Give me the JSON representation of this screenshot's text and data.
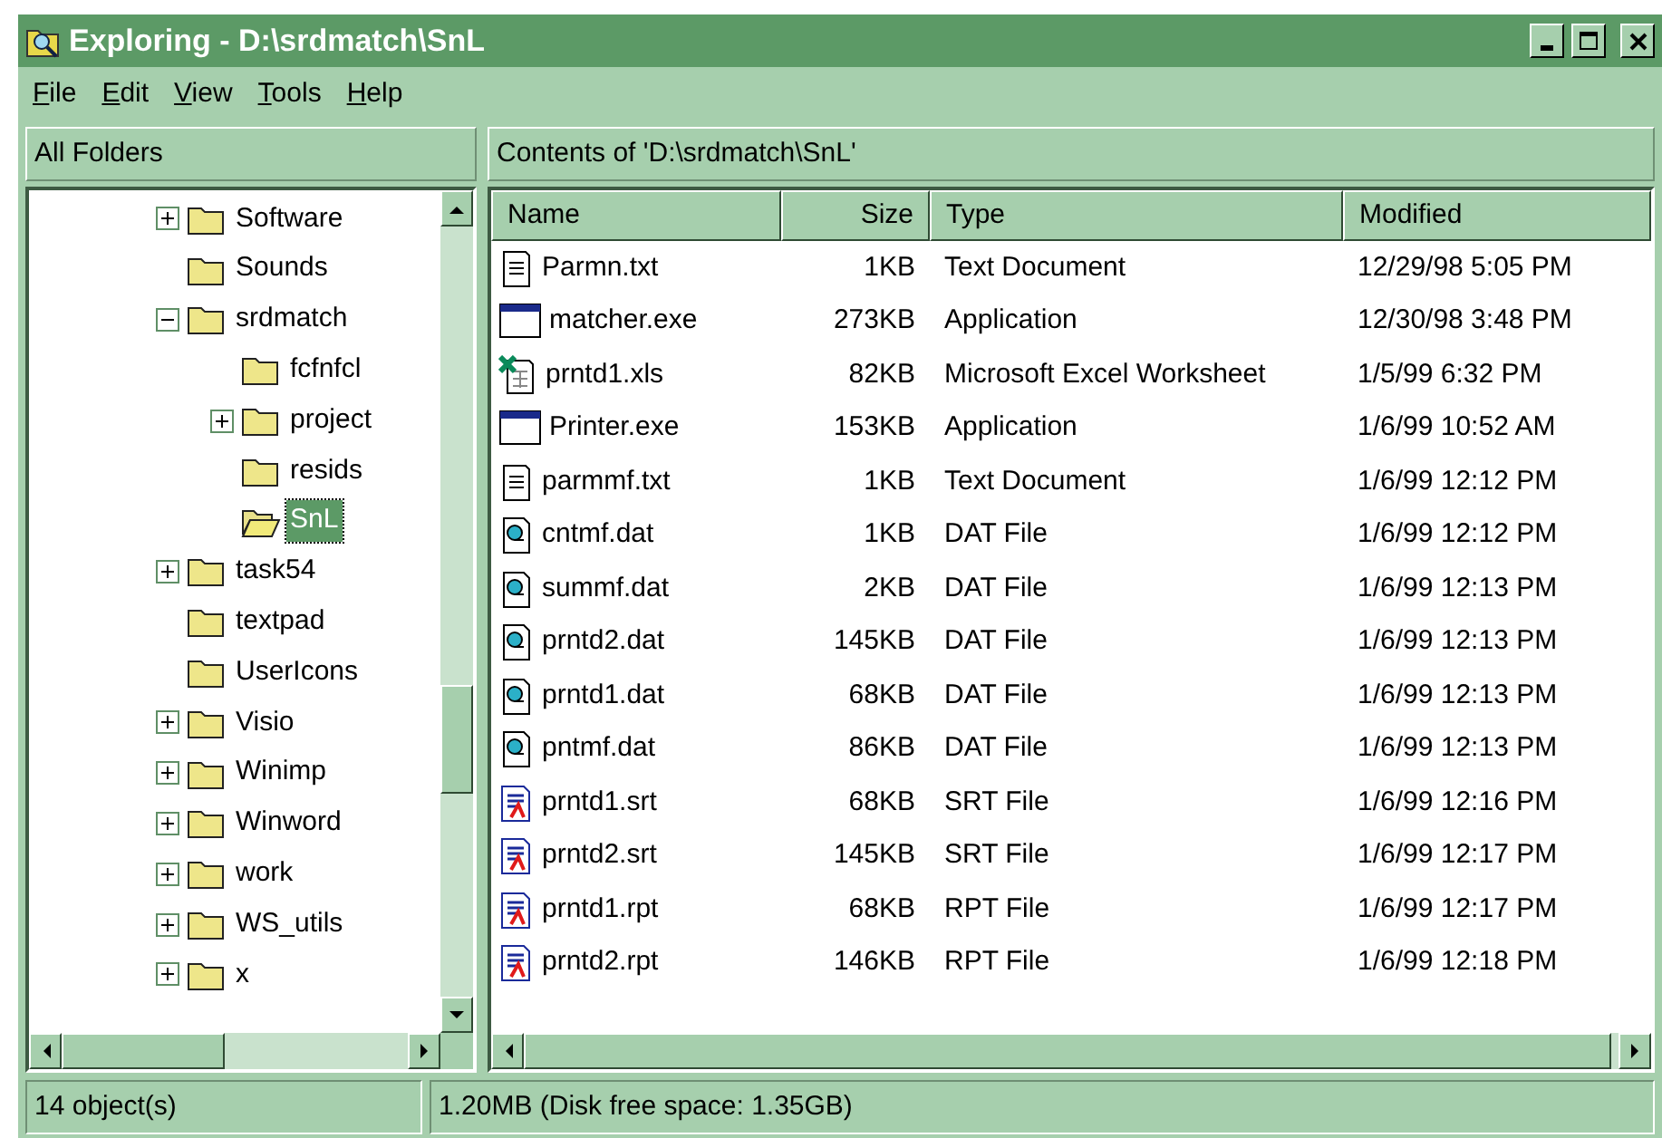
{
  "window": {
    "title": "Exploring - D:\\srdmatch\\SnL"
  },
  "menu": [
    {
      "label": "File"
    },
    {
      "label": "Edit"
    },
    {
      "label": "View"
    },
    {
      "label": "Tools"
    },
    {
      "label": "Help"
    }
  ],
  "folders_header": "All Folders",
  "contents_header": "Contents of 'D:\\srdmatch\\SnL'",
  "tree": [
    {
      "kind": "branch",
      "label": "Software",
      "expanded": false,
      "selected": false
    },
    {
      "kind": "leaf",
      "label": "Sounds",
      "selected": false
    },
    {
      "kind": "branch",
      "label": "srdmatch",
      "expanded": true,
      "selected": false,
      "children": [
        {
          "kind": "leaf",
          "label": "fcfnfcl",
          "selected": false
        },
        {
          "kind": "branch",
          "label": "project",
          "expanded": false,
          "selected": false
        },
        {
          "kind": "leaf",
          "label": "resids",
          "selected": false
        },
        {
          "kind": "leaf",
          "label": "SnL",
          "selected": true
        }
      ]
    },
    {
      "kind": "branch",
      "label": "task54",
      "expanded": false,
      "selected": false
    },
    {
      "kind": "leaf",
      "label": "textpad",
      "selected": false
    },
    {
      "kind": "leaf",
      "label": "UserIcons",
      "selected": false
    },
    {
      "kind": "branch",
      "label": "Visio",
      "expanded": false,
      "selected": false
    },
    {
      "kind": "branch",
      "label": "Winimp",
      "expanded": false,
      "selected": false
    },
    {
      "kind": "branch",
      "label": "Winword",
      "expanded": false,
      "selected": false
    },
    {
      "kind": "branch",
      "label": "work",
      "expanded": false,
      "selected": false
    },
    {
      "kind": "branch",
      "label": "WS_utils",
      "expanded": false,
      "selected": false
    },
    {
      "kind": "branch",
      "label": "x",
      "expanded": false,
      "selected": false
    }
  ],
  "table": {
    "columns": [
      "Name",
      "Size",
      "Type",
      "Modified"
    ],
    "rows": [
      {
        "kind": "text",
        "name": "Parmn.txt",
        "size": "1KB",
        "type": "Text Document",
        "modified": "12/29/98 5:05 PM"
      },
      {
        "kind": "app",
        "name": "matcher.exe",
        "size": "273KB",
        "type": "Application",
        "modified": "12/30/98 3:48 PM"
      },
      {
        "kind": "excel",
        "name": "prntd1.xls",
        "size": "82KB",
        "type": "Microsoft Excel Worksheet",
        "modified": "1/5/99 6:32 PM"
      },
      {
        "kind": "app",
        "name": "Printer.exe",
        "size": "153KB",
        "type": "Application",
        "modified": "1/6/99 10:52 AM"
      },
      {
        "kind": "text",
        "name": "parmmf.txt",
        "size": "1KB",
        "type": "Text Document",
        "modified": "1/6/99 12:12 PM"
      },
      {
        "kind": "dat",
        "name": "cntmf.dat",
        "size": "1KB",
        "type": "DAT File",
        "modified": "1/6/99 12:12 PM"
      },
      {
        "kind": "dat",
        "name": "summf.dat",
        "size": "2KB",
        "type": "DAT File",
        "modified": "1/6/99 12:13 PM"
      },
      {
        "kind": "dat",
        "name": "prntd2.dat",
        "size": "145KB",
        "type": "DAT File",
        "modified": "1/6/99 12:13 PM"
      },
      {
        "kind": "dat",
        "name": "prntd1.dat",
        "size": "68KB",
        "type": "DAT File",
        "modified": "1/6/99 12:13 PM"
      },
      {
        "kind": "dat",
        "name": "pntmf.dat",
        "size": "86KB",
        "type": "DAT File",
        "modified": "1/6/99 12:13 PM"
      },
      {
        "kind": "report",
        "name": "prntd1.srt",
        "size": "68KB",
        "type": "SRT File",
        "modified": "1/6/99 12:16 PM"
      },
      {
        "kind": "report",
        "name": "prntd2.srt",
        "size": "145KB",
        "type": "SRT File",
        "modified": "1/6/99 12:17 PM"
      },
      {
        "kind": "report",
        "name": "prntd1.rpt",
        "size": "68KB",
        "type": "RPT File",
        "modified": "1/6/99 12:17 PM"
      },
      {
        "kind": "report",
        "name": "prntd2.rpt",
        "size": "146KB",
        "type": "RPT File",
        "modified": "1/6/99 12:18 PM"
      }
    ]
  },
  "status_bar": [
    "14 object(s)",
    "1.20MB (Disk free space: 1.35GB)"
  ]
}
